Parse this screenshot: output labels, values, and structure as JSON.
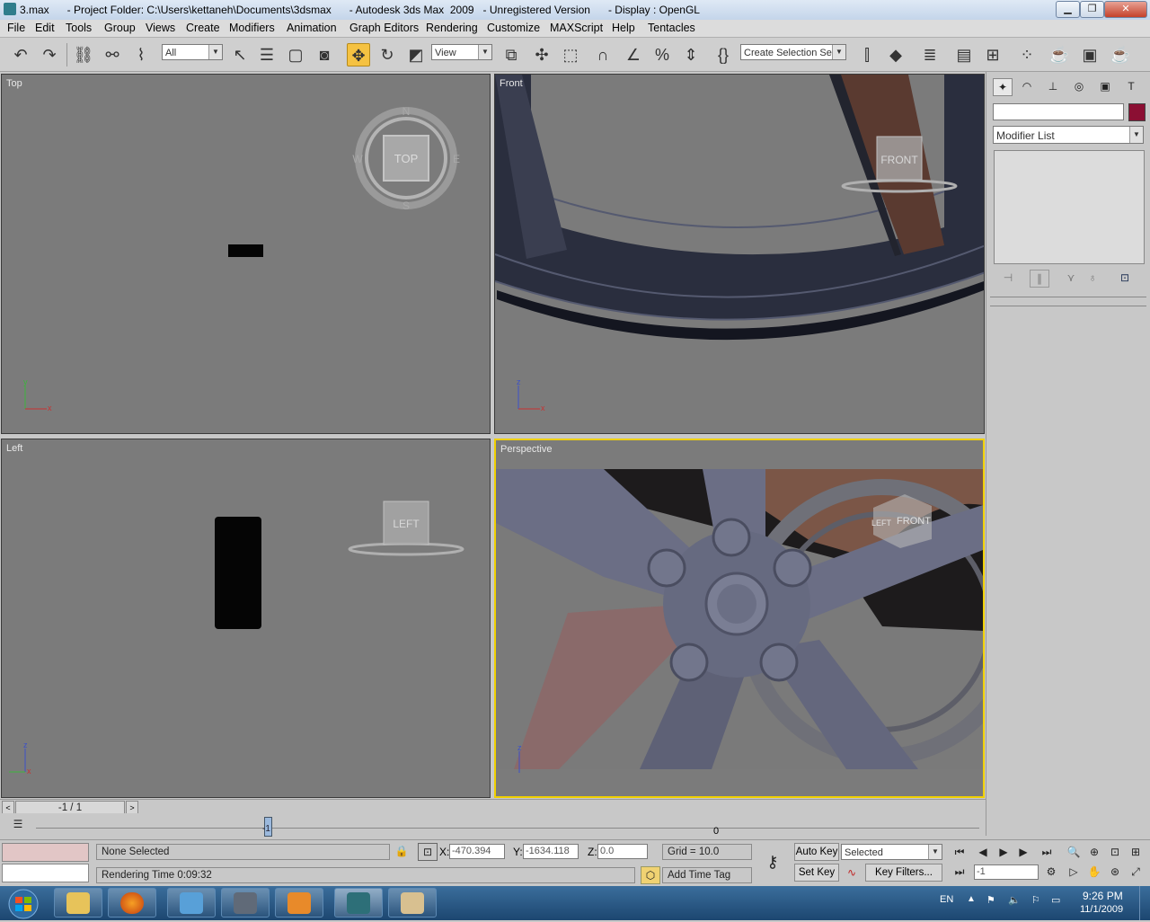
{
  "titlebar": {
    "text": "3.max      - Project Folder: C:\\Users\\kettaneh\\Documents\\3dsmax      - Autodesk 3ds Max  2009   - Unregistered Version      - Display : OpenGL",
    "minimize": "▁",
    "restore": "❐",
    "close": "✕"
  },
  "menu": [
    "File",
    "Edit",
    "Tools",
    "Group",
    "Views",
    "Create",
    "Modifiers",
    "Animation",
    "Graph Editors",
    "Rendering",
    "Customize",
    "MAXScript",
    "Help",
    "Tentacles"
  ],
  "toolbar": {
    "selection_filter": "All",
    "ref_coord": "View",
    "named_selection": "Create Selection Set"
  },
  "viewports": {
    "top": {
      "label": "Top",
      "cube": "TOP",
      "n": "N",
      "s": "S",
      "e": "E",
      "w": "W"
    },
    "front": {
      "label": "Front",
      "cube": "FRONT"
    },
    "left": {
      "label": "Left",
      "cube": "LEFT"
    },
    "perspective": {
      "label": "Perspective",
      "cube_a": "FRONT",
      "cube_b": "LEFT"
    }
  },
  "axes": {
    "x": "x",
    "y": "y",
    "z": "z"
  },
  "command_panel": {
    "modifier_list": "Modifier List",
    "swatch_color": "#8b0f33"
  },
  "trackbar": {
    "frame_counter": "-1 / 1",
    "frame_marker": "0",
    "slider_value": "-1"
  },
  "status": {
    "selection": "None Selected",
    "prompt": "Rendering Time  0:09:32",
    "x_label": "X:",
    "x_value": "-470.394",
    "y_label": "Y:",
    "y_value": "-1634.118",
    "z_label": "Z:",
    "z_value": "0.0",
    "grid": "Grid = 10.0",
    "add_time_tag": "Add Time Tag",
    "auto_key": "Auto Key",
    "set_key": "Set Key",
    "key_mode": "Selected",
    "key_filters": "Key Filters...",
    "current_frame": "-1"
  },
  "tray": {
    "lang": "EN",
    "time": "9:26 PM",
    "date": "11/1/2009"
  }
}
